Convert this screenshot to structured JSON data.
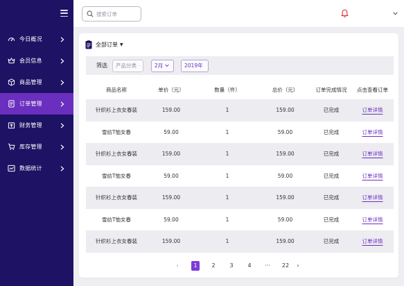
{
  "sidebar": {
    "items": [
      {
        "label": "今日概况",
        "icon": "dashboard-gauge-icon",
        "active": false
      },
      {
        "label": "会员信息",
        "icon": "crown-icon",
        "active": false
      },
      {
        "label": "商品管理",
        "icon": "box-icon",
        "active": false
      },
      {
        "label": "订单管理",
        "icon": "document-icon",
        "active": true
      },
      {
        "label": "财务管理",
        "icon": "wallet-icon",
        "active": false
      },
      {
        "label": "库存管理",
        "icon": "cart-icon",
        "active": false
      },
      {
        "label": "数据统计",
        "icon": "line-chart-icon",
        "active": false
      }
    ]
  },
  "topbar": {
    "search_placeholder": "搜索订单"
  },
  "card": {
    "title": "全部订单",
    "filter": {
      "label": "筛选",
      "category": "产品分类",
      "month": "2月",
      "year": "2019年"
    }
  },
  "table": {
    "headers": [
      "商品名称",
      "单价（元）",
      "数量（件）",
      "总价（元）",
      "订单完成情况",
      "点击查看订单"
    ],
    "rows": [
      {
        "name": "针织衫上衣女春装",
        "price": "159.00",
        "qty": "1",
        "total": "159.00",
        "status": "已完成",
        "action": "订单详情"
      },
      {
        "name": "雪纺T恤女春",
        "price": "59.00",
        "qty": "1",
        "total": "59.00",
        "status": "已完成",
        "action": "订单详情"
      },
      {
        "name": "针织衫上衣女春装",
        "price": "159.00",
        "qty": "1",
        "total": "159.00",
        "status": "已完成",
        "action": "订单详情"
      },
      {
        "name": "雪纺T恤女春",
        "price": "59.00",
        "qty": "1",
        "total": "59.00",
        "status": "已完成",
        "action": "订单详情"
      },
      {
        "name": "针织衫上衣女春装",
        "price": "159.00",
        "qty": "1",
        "total": "159.00",
        "status": "已完成",
        "action": "订单详情"
      },
      {
        "name": "雪纺T恤女春",
        "price": "59.00",
        "qty": "1",
        "total": "59.00",
        "status": "已完成",
        "action": "订单详情"
      },
      {
        "name": "针织衫上衣女春装",
        "price": "159.00",
        "qty": "1",
        "total": "159.00",
        "status": "已完成",
        "action": "订单详情"
      }
    ]
  },
  "pagination": {
    "prev": "‹",
    "pages": [
      "1",
      "2",
      "3",
      "4"
    ],
    "ellipsis": "···",
    "last": "22",
    "next": "›",
    "current": "1"
  },
  "colors": {
    "sidebar_bg": "#1d1263",
    "active_item": "#6a2fbe",
    "accent": "#7b3ed6",
    "bell": "#d9302c"
  }
}
